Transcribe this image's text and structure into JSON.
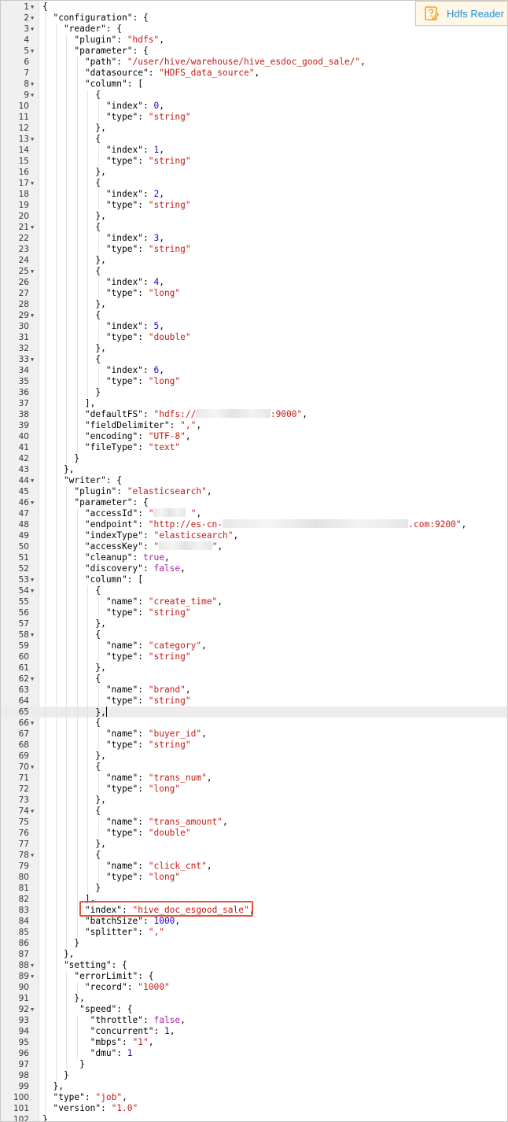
{
  "editor": {
    "active_line": 65,
    "lines": [
      [
        [
          "p",
          "{"
        ]
      ],
      [
        [
          "k",
          "  \"configuration\""
        ],
        [
          "p",
          ": {"
        ]
      ],
      [
        [
          "k",
          "    \"reader\""
        ],
        [
          "p",
          ": {"
        ]
      ],
      [
        [
          "k",
          "      \"plugin\""
        ],
        [
          "p",
          ": "
        ],
        [
          "s",
          "\"hdfs\""
        ],
        [
          "p",
          ","
        ]
      ],
      [
        [
          "k",
          "      \"parameter\""
        ],
        [
          "p",
          ": {"
        ]
      ],
      [
        [
          "k",
          "        \"path\""
        ],
        [
          "p",
          ": "
        ],
        [
          "s",
          "\"/user/hive/warehouse/hive_esdoc_good_sale/\""
        ],
        [
          "p",
          ","
        ]
      ],
      [
        [
          "k",
          "        \"datasource\""
        ],
        [
          "p",
          ": "
        ],
        [
          "s",
          "\"HDFS_data_source\""
        ],
        [
          "p",
          ","
        ]
      ],
      [
        [
          "k",
          "        \"column\""
        ],
        [
          "p",
          ": ["
        ]
      ],
      [
        [
          "p",
          "          {"
        ]
      ],
      [
        [
          "k",
          "            \"index\""
        ],
        [
          "p",
          ": "
        ],
        [
          "n",
          "0"
        ],
        [
          "p",
          ","
        ]
      ],
      [
        [
          "k",
          "            \"type\""
        ],
        [
          "p",
          ": "
        ],
        [
          "s",
          "\"string\""
        ]
      ],
      [
        [
          "p",
          "          },"
        ]
      ],
      [
        [
          "p",
          "          {"
        ]
      ],
      [
        [
          "k",
          "            \"index\""
        ],
        [
          "p",
          ": "
        ],
        [
          "n",
          "1"
        ],
        [
          "p",
          ","
        ]
      ],
      [
        [
          "k",
          "            \"type\""
        ],
        [
          "p",
          ": "
        ],
        [
          "s",
          "\"string\""
        ]
      ],
      [
        [
          "p",
          "          },"
        ]
      ],
      [
        [
          "p",
          "          {"
        ]
      ],
      [
        [
          "k",
          "            \"index\""
        ],
        [
          "p",
          ": "
        ],
        [
          "n",
          "2"
        ],
        [
          "p",
          ","
        ]
      ],
      [
        [
          "k",
          "            \"type\""
        ],
        [
          "p",
          ": "
        ],
        [
          "s",
          "\"string\""
        ]
      ],
      [
        [
          "p",
          "          },"
        ]
      ],
      [
        [
          "p",
          "          {"
        ]
      ],
      [
        [
          "k",
          "            \"index\""
        ],
        [
          "p",
          ": "
        ],
        [
          "n",
          "3"
        ],
        [
          "p",
          ","
        ]
      ],
      [
        [
          "k",
          "            \"type\""
        ],
        [
          "p",
          ": "
        ],
        [
          "s",
          "\"string\""
        ]
      ],
      [
        [
          "p",
          "          },"
        ]
      ],
      [
        [
          "p",
          "          {"
        ]
      ],
      [
        [
          "k",
          "            \"index\""
        ],
        [
          "p",
          ": "
        ],
        [
          "n",
          "4"
        ],
        [
          "p",
          ","
        ]
      ],
      [
        [
          "k",
          "            \"type\""
        ],
        [
          "p",
          ": "
        ],
        [
          "s",
          "\"long\""
        ]
      ],
      [
        [
          "p",
          "          },"
        ]
      ],
      [
        [
          "p",
          "          {"
        ]
      ],
      [
        [
          "k",
          "            \"index\""
        ],
        [
          "p",
          ": "
        ],
        [
          "n",
          "5"
        ],
        [
          "p",
          ","
        ]
      ],
      [
        [
          "k",
          "            \"type\""
        ],
        [
          "p",
          ": "
        ],
        [
          "s",
          "\"double\""
        ]
      ],
      [
        [
          "p",
          "          },"
        ]
      ],
      [
        [
          "p",
          "          {"
        ]
      ],
      [
        [
          "k",
          "            \"index\""
        ],
        [
          "p",
          ": "
        ],
        [
          "n",
          "6"
        ],
        [
          "p",
          ","
        ]
      ],
      [
        [
          "k",
          "            \"type\""
        ],
        [
          "p",
          ": "
        ],
        [
          "s",
          "\"long\""
        ]
      ],
      [
        [
          "p",
          "          }"
        ]
      ],
      [
        [
          "p",
          "        ],"
        ]
      ],
      [
        [
          "k",
          "        \"defaultFS\""
        ],
        [
          "p",
          ": "
        ],
        [
          "s",
          "\"hdfs://"
        ],
        [
          "m",
          14
        ],
        [
          "s",
          ":9000\""
        ],
        [
          "p",
          ","
        ]
      ],
      [
        [
          "k",
          "        \"fieldDelimiter\""
        ],
        [
          "p",
          ": "
        ],
        [
          "s",
          "\",\""
        ],
        [
          "p",
          ","
        ]
      ],
      [
        [
          "k",
          "        \"encoding\""
        ],
        [
          "p",
          ": "
        ],
        [
          "s",
          "\"UTF-8\""
        ],
        [
          "p",
          ","
        ]
      ],
      [
        [
          "k",
          "        \"fileType\""
        ],
        [
          "p",
          ": "
        ],
        [
          "s",
          "\"text\""
        ]
      ],
      [
        [
          "p",
          "      }"
        ]
      ],
      [
        [
          "p",
          "    },"
        ]
      ],
      [
        [
          "k",
          "    \"writer\""
        ],
        [
          "p",
          ": {"
        ]
      ],
      [
        [
          "k",
          "      \"plugin\""
        ],
        [
          "p",
          ": "
        ],
        [
          "s",
          "\"elasticsearch\""
        ],
        [
          "p",
          ","
        ]
      ],
      [
        [
          "k",
          "      \"parameter\""
        ],
        [
          "p",
          ": {"
        ]
      ],
      [
        [
          "k",
          "        \"accessId\""
        ],
        [
          "p",
          ": "
        ],
        [
          "s",
          "\""
        ],
        [
          "m",
          6
        ],
        [
          "s",
          " \""
        ],
        [
          "p",
          ","
        ]
      ],
      [
        [
          "k",
          "        \"endpoint\""
        ],
        [
          "p",
          ": "
        ],
        [
          "s",
          "\"http://es-cn-"
        ],
        [
          "m",
          35
        ],
        [
          "s",
          ".com:9200\""
        ],
        [
          "p",
          ","
        ]
      ],
      [
        [
          "k",
          "        \"indexType\""
        ],
        [
          "p",
          ": "
        ],
        [
          "s",
          "\"elasticsearch\""
        ],
        [
          "p",
          ","
        ]
      ],
      [
        [
          "k",
          "        \"accessKey\""
        ],
        [
          "p",
          ": "
        ],
        [
          "s",
          "\""
        ],
        [
          "m",
          10
        ],
        [
          "s",
          "\""
        ],
        [
          "p",
          ","
        ]
      ],
      [
        [
          "k",
          "        \"cleanup\""
        ],
        [
          "p",
          ": "
        ],
        [
          "b",
          "true"
        ],
        [
          "p",
          ","
        ]
      ],
      [
        [
          "k",
          "        \"discovery\""
        ],
        [
          "p",
          ": "
        ],
        [
          "b",
          "false"
        ],
        [
          "p",
          ","
        ]
      ],
      [
        [
          "k",
          "        \"column\""
        ],
        [
          "p",
          ": ["
        ]
      ],
      [
        [
          "p",
          "          {"
        ]
      ],
      [
        [
          "k",
          "            \"name\""
        ],
        [
          "p",
          ": "
        ],
        [
          "s",
          "\"create_time\""
        ],
        [
          "p",
          ","
        ]
      ],
      [
        [
          "k",
          "            \"type\""
        ],
        [
          "p",
          ": "
        ],
        [
          "s",
          "\"string\""
        ]
      ],
      [
        [
          "p",
          "          },"
        ]
      ],
      [
        [
          "p",
          "          {"
        ]
      ],
      [
        [
          "k",
          "            \"name\""
        ],
        [
          "p",
          ": "
        ],
        [
          "s",
          "\"category\""
        ],
        [
          "p",
          ","
        ]
      ],
      [
        [
          "k",
          "            \"type\""
        ],
        [
          "p",
          ": "
        ],
        [
          "s",
          "\"string\""
        ]
      ],
      [
        [
          "p",
          "          },"
        ]
      ],
      [
        [
          "p",
          "          {"
        ]
      ],
      [
        [
          "k",
          "            \"name\""
        ],
        [
          "p",
          ": "
        ],
        [
          "s",
          "\"brand\""
        ],
        [
          "p",
          ","
        ]
      ],
      [
        [
          "k",
          "            \"type\""
        ],
        [
          "p",
          ": "
        ],
        [
          "s",
          "\"string\""
        ]
      ],
      [
        [
          "p",
          "          },"
        ],
        [
          "c",
          ""
        ]
      ],
      [
        [
          "p",
          "          {"
        ]
      ],
      [
        [
          "k",
          "            \"name\""
        ],
        [
          "p",
          ": "
        ],
        [
          "s",
          "\"buyer_id\""
        ],
        [
          "p",
          ","
        ]
      ],
      [
        [
          "k",
          "            \"type\""
        ],
        [
          "p",
          ": "
        ],
        [
          "s",
          "\"string\""
        ]
      ],
      [
        [
          "p",
          "          },"
        ]
      ],
      [
        [
          "p",
          "          {"
        ]
      ],
      [
        [
          "k",
          "            \"name\""
        ],
        [
          "p",
          ": "
        ],
        [
          "s",
          "\"trans_num\""
        ],
        [
          "p",
          ","
        ]
      ],
      [
        [
          "k",
          "            \"type\""
        ],
        [
          "p",
          ": "
        ],
        [
          "s",
          "\"long\""
        ]
      ],
      [
        [
          "p",
          "          },"
        ]
      ],
      [
        [
          "p",
          "          {"
        ]
      ],
      [
        [
          "k",
          "            \"name\""
        ],
        [
          "p",
          ": "
        ],
        [
          "s",
          "\"trans_amount\""
        ],
        [
          "p",
          ","
        ]
      ],
      [
        [
          "k",
          "            \"type\""
        ],
        [
          "p",
          ": "
        ],
        [
          "s",
          "\"double\""
        ]
      ],
      [
        [
          "p",
          "          },"
        ]
      ],
      [
        [
          "p",
          "          {"
        ]
      ],
      [
        [
          "k",
          "            \"name\""
        ],
        [
          "p",
          ": "
        ],
        [
          "s",
          "\"click_cnt\""
        ],
        [
          "p",
          ","
        ]
      ],
      [
        [
          "k",
          "            \"type\""
        ],
        [
          "p",
          ": "
        ],
        [
          "s",
          "\"long\""
        ]
      ],
      [
        [
          "p",
          "          }"
        ]
      ],
      [
        [
          "p",
          "        ],"
        ]
      ],
      [
        [
          "k",
          "        \"index\""
        ],
        [
          "p",
          ": "
        ],
        [
          "s",
          "\"hive_doc_esgood_sale\""
        ],
        [
          "p",
          ","
        ]
      ],
      [
        [
          "k",
          "        \"batchSize\""
        ],
        [
          "p",
          ": "
        ],
        [
          "n",
          "1000"
        ],
        [
          "p",
          ","
        ]
      ],
      [
        [
          "k",
          "        \"splitter\""
        ],
        [
          "p",
          ": "
        ],
        [
          "s",
          "\",\""
        ]
      ],
      [
        [
          "p",
          "      }"
        ]
      ],
      [
        [
          "p",
          "    },"
        ]
      ],
      [
        [
          "k",
          "    \"setting\""
        ],
        [
          "p",
          ": {"
        ]
      ],
      [
        [
          "k",
          "      \"errorLimit\""
        ],
        [
          "p",
          ": {"
        ]
      ],
      [
        [
          "k",
          "        \"record\""
        ],
        [
          "p",
          ": "
        ],
        [
          "s",
          "\"1000\""
        ]
      ],
      [
        [
          "p",
          "      },"
        ]
      ],
      [
        [
          "k",
          "       \"speed\""
        ],
        [
          "p",
          ": {"
        ]
      ],
      [
        [
          "k",
          "         \"throttle\""
        ],
        [
          "p",
          ": "
        ],
        [
          "b",
          "false"
        ],
        [
          "p",
          ","
        ]
      ],
      [
        [
          "k",
          "         \"concurrent\""
        ],
        [
          "p",
          ": "
        ],
        [
          "n",
          "1"
        ],
        [
          "p",
          ","
        ]
      ],
      [
        [
          "k",
          "         \"mbps\""
        ],
        [
          "p",
          ": "
        ],
        [
          "s",
          "\"1\""
        ],
        [
          "p",
          ","
        ]
      ],
      [
        [
          "k",
          "         \"dmu\""
        ],
        [
          "p",
          ": "
        ],
        [
          "n",
          "1"
        ]
      ],
      [
        [
          "p",
          "       }"
        ]
      ],
      [
        [
          "p",
          "    }"
        ]
      ],
      [
        [
          "p",
          "  },"
        ]
      ],
      [
        [
          "k",
          "  \"type\""
        ],
        [
          "p",
          ": "
        ],
        [
          "s",
          "\"job\""
        ],
        [
          "p",
          ","
        ]
      ],
      [
        [
          "k",
          "  \"version\""
        ],
        [
          "p",
          ": "
        ],
        [
          "s",
          "\"1.0\""
        ]
      ],
      [
        [
          "p",
          "}"
        ]
      ]
    ]
  },
  "annotation": {
    "label": "Hdfs Reader",
    "color": "#1a8fe0",
    "box_color": "#e0533c"
  }
}
